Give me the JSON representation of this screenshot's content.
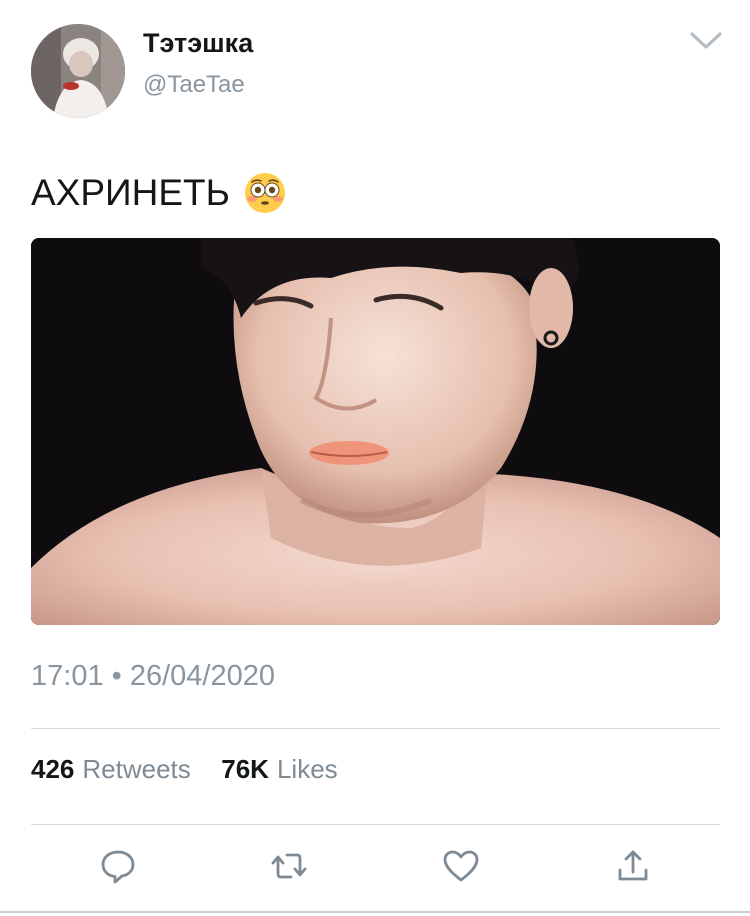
{
  "author": {
    "display_name": "Тэтэшка",
    "handle": "@TaeTae",
    "avatar_icon": "profile-photo"
  },
  "tweet": {
    "text": "АХРИНЕТЬ",
    "emoji": "flushed-face-emoji",
    "media_type": "photo",
    "timestamp": "17:01 • 26/04/2020"
  },
  "stats": {
    "retweets_count": "426",
    "retweets_label": "Retweets",
    "likes_count": "76K",
    "likes_label": "Likes"
  },
  "actions": [
    "reply-icon",
    "retweet-icon",
    "like-icon",
    "share-icon"
  ],
  "colors": {
    "text_primary": "#14171a",
    "text_secondary": "#8a969f",
    "action_icon": "#7f8b94",
    "divider": "#d5dbe0"
  }
}
